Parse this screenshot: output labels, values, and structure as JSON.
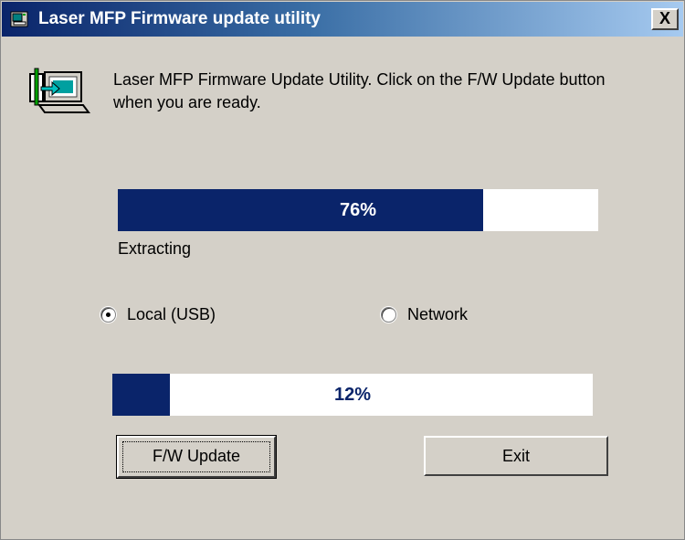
{
  "window": {
    "title": "Laser MFP Firmware update utility",
    "close_label": "X",
    "title_gradient": [
      "#0a246a",
      "#a6caf0"
    ],
    "background": "#d4d0c8"
  },
  "message": "Laser MFP Firmware Update Utility. Click on the F/W Update button when you are ready.",
  "icons": {
    "title_icon": "printer-icon",
    "app_icon": "computer-update-icon"
  },
  "extract_progress": {
    "value": 76,
    "label": "76%",
    "status": "Extracting"
  },
  "connection": {
    "selected": "local",
    "options": [
      {
        "id": "local",
        "label": "Local (USB)"
      },
      {
        "id": "network",
        "label": "Network"
      }
    ]
  },
  "update_progress": {
    "value": 12,
    "label": "12%"
  },
  "buttons": {
    "update": "F/W Update",
    "exit": "Exit"
  },
  "colors": {
    "progress_fill": "#0a246a",
    "progress_track": "#ffffff"
  }
}
